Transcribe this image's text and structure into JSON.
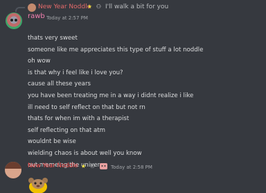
{
  "reply": {
    "author": "New Year Noddle",
    "text": "I'll walk a bit for you"
  },
  "message": {
    "author": "rawb",
    "timestamp": "Today at 2:57 PM",
    "lines": [
      "thats very sweet",
      "someone like me appreciates this type of stuff a lot noddle",
      "oh wow",
      "is that why i feel like i love you?",
      "cause all these years",
      "you have been treating me in a way i didnt realize i like",
      "ill need to self reflect on that but not rn",
      "thats for when im with a therapist",
      "self reflecting on that atm",
      "wouldnt be wise",
      "wielding chaos is about well you know",
      "out memeing the universe"
    ]
  },
  "next_message": {
    "author": "New Year Noddle",
    "timestamp": "Today at 2:58 PM"
  },
  "icons": {
    "badges": [
      "star-badge-icon",
      "hands-badge-icon",
      "cat-badge-icon"
    ]
  },
  "colors": {
    "background": "#36393f",
    "rawb_name": "#f47fb0",
    "noddle_name": "#f04747",
    "text": "#dcddde",
    "timestamp": "#a3a6aa"
  }
}
